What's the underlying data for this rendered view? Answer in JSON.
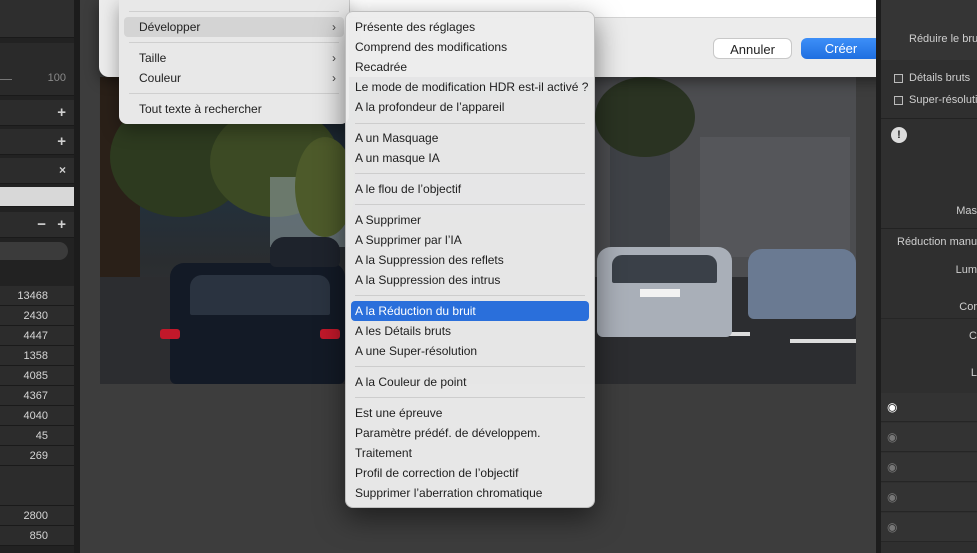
{
  "left_panel": {
    "slider_value": "100",
    "numbers": [
      "13468",
      "2430",
      "4447",
      "1358",
      "4085",
      "4367",
      "4040",
      "45",
      "269",
      "2800",
      "850"
    ]
  },
  "dialog": {
    "cancel_label": "Annuler",
    "create_label": "Créer"
  },
  "menu_left": {
    "items": [
      "Développer",
      "Taille",
      "Couleur",
      "Tout texte à rechercher"
    ]
  },
  "menu_main": {
    "items": [
      "Présente des réglages",
      "Comprend des modifications",
      "Recadrée",
      "Le mode de modification HDR est-il activé ?",
      "A la profondeur de l’appareil",
      "A un Masquage",
      "A un masque IA",
      "A le flou de l’objectif",
      "A Supprimer",
      "A Supprimer par l’IA",
      "A la Suppression des reflets",
      "A la Suppression des intrus",
      "A la Réduction du bruit",
      "A les Détails bruts",
      "A une Super-résolution",
      "A la Couleur de point",
      "Est une épreuve",
      "Paramètre prédéf. de développem.",
      "Traitement",
      "Profil de correction de l’objectif",
      "Supprimer l’aberration chromatique"
    ],
    "selected": "A la Réduction du bruit"
  },
  "right_panel": {
    "header": "Réduire le bruit",
    "check1": "Détails bruts",
    "check2": "Super-résolution",
    "label_mas": "Mas",
    "label_reduction": "Réduction manu",
    "label_lum": "Lum",
    "label_cor": "Cor",
    "label_c": "C",
    "label_l": "L"
  },
  "colors": {
    "accent": "#2a6fdb",
    "create_button": "#1f6fe0"
  }
}
